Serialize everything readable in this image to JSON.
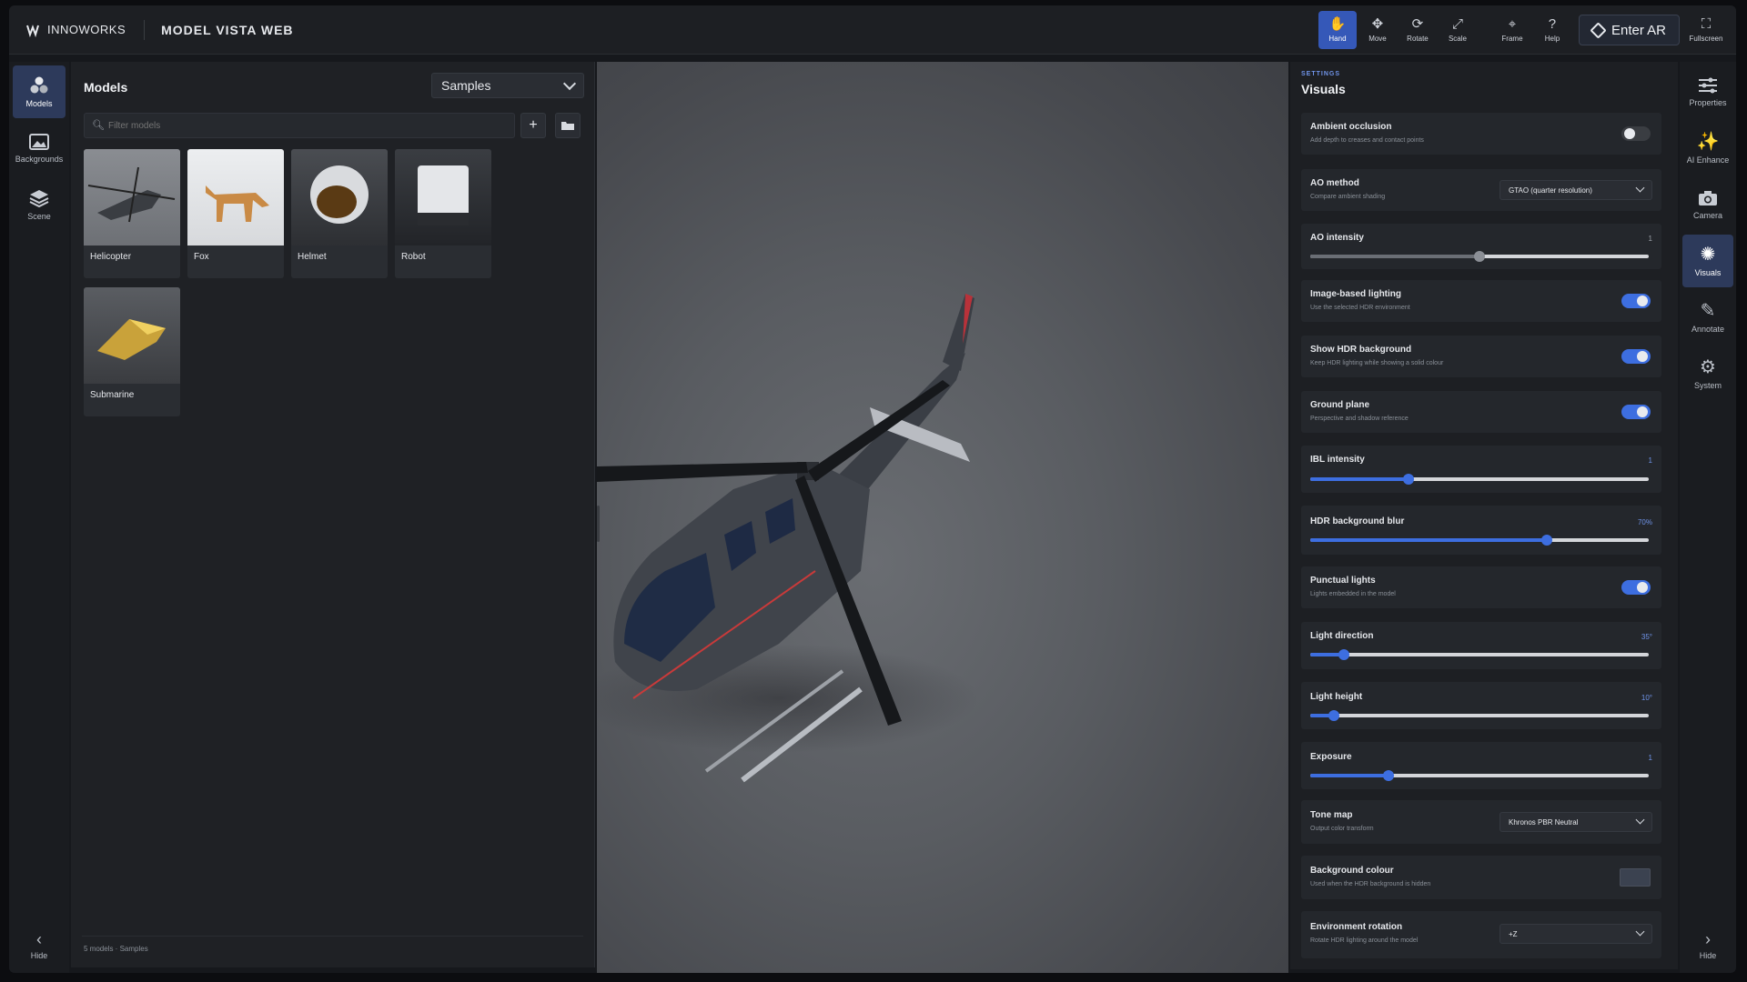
{
  "brand": {
    "name": "INNOWORKS",
    "app_title": "MODEL VISTA WEB"
  },
  "toolbar": {
    "tools": [
      {
        "label": "Hand",
        "icon": "hand-icon",
        "active": true
      },
      {
        "label": "Move",
        "icon": "move-icon",
        "active": false
      },
      {
        "label": "Rotate",
        "icon": "rotate-icon",
        "active": false
      },
      {
        "label": "Scale",
        "icon": "scale-icon",
        "active": false
      },
      {
        "label": "Frame",
        "icon": "frame-icon",
        "active": false
      },
      {
        "label": "Help",
        "icon": "help-icon",
        "active": false
      }
    ],
    "enter_ar": "Enter AR",
    "fullscreen": "Fullscreen"
  },
  "left_rail": {
    "items": [
      {
        "label": "Models",
        "icon": "models-icon",
        "active": true
      },
      {
        "label": "Backgrounds",
        "icon": "image-icon",
        "active": false
      },
      {
        "label": "Scene",
        "icon": "layers-icon",
        "active": false
      }
    ],
    "hide": "Hide"
  },
  "models_panel": {
    "title": "Models",
    "source_select": "Samples",
    "filter_placeholder": "Filter models",
    "models": [
      "Helicopter",
      "Fox",
      "Helmet",
      "Robot",
      "Submarine"
    ],
    "footer": "5 models · Samples"
  },
  "settings": {
    "kicker": "SETTINGS",
    "title": "Visuals",
    "ambient_occlusion": {
      "label": "Ambient occlusion",
      "sub": "Add depth to creases and contact points",
      "on": false
    },
    "ao_method": {
      "label": "AO method",
      "sub": "Compare ambient shading",
      "value": "GTAO (quarter resolution)"
    },
    "ao_intensity": {
      "label": "AO intensity",
      "value": "1",
      "fraction": 0.5
    },
    "ibl": {
      "label": "Image-based lighting",
      "sub": "Use the selected HDR environment",
      "on": true
    },
    "show_hdr": {
      "label": "Show HDR background",
      "sub": "Keep HDR lighting while showing a solid colour",
      "on": true
    },
    "ground_plane": {
      "label": "Ground plane",
      "sub": "Perspective and shadow reference",
      "on": true
    },
    "ibl_intensity": {
      "label": "IBL intensity",
      "value": "1",
      "fraction": 0.29
    },
    "hdr_blur": {
      "label": "HDR background blur",
      "value": "70%",
      "fraction": 0.7
    },
    "punctual_lights": {
      "label": "Punctual lights",
      "sub": "Lights embedded in the model",
      "on": true
    },
    "light_direction": {
      "label": "Light direction",
      "value": "35°",
      "fraction": 0.1
    },
    "light_height": {
      "label": "Light height",
      "value": "10°",
      "fraction": 0.07
    },
    "exposure": {
      "label": "Exposure",
      "value": "1",
      "fraction": 0.23
    },
    "tone_map": {
      "label": "Tone map",
      "sub": "Output color transform",
      "value": "Khronos PBR Neutral"
    },
    "background_colour": {
      "label": "Background colour",
      "sub": "Used when the HDR background is hidden",
      "color": "#3b4250"
    },
    "env_rotation": {
      "label": "Environment rotation",
      "sub": "Rotate HDR lighting around the model",
      "value": "+Z"
    }
  },
  "right_rail": {
    "items": [
      {
        "label": "Properties",
        "icon": "sliders-icon",
        "active": false
      },
      {
        "label": "AI Enhance",
        "icon": "magic-wand-icon",
        "active": false
      },
      {
        "label": "Camera",
        "icon": "camera-icon",
        "active": false
      },
      {
        "label": "Visuals",
        "icon": "sun-icon",
        "active": true
      },
      {
        "label": "Annotate",
        "icon": "pencil-icon",
        "active": false
      },
      {
        "label": "System",
        "icon": "gear-icon",
        "active": false
      }
    ],
    "hide": "Hide"
  },
  "colors": {
    "accent": "#3d6ee0",
    "active_tool": "#3558b8"
  }
}
